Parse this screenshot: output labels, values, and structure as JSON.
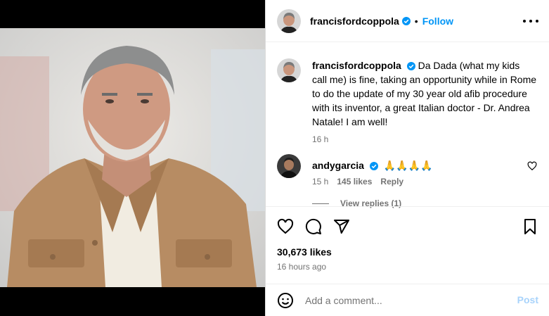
{
  "post": {
    "author": "francisfordcoppola",
    "follow_label": "Follow",
    "separator": "•",
    "caption": "Da Dada (what my kids call me) is fine, taking an opportunity while in Rome to do the update of my 30 year old afib procedure with its inventor, a great Italian doctor - Dr. Andrea Natale! I am well!",
    "caption_time": "16 h",
    "likes": "30,673 likes",
    "time_ago": "16 hours ago"
  },
  "comments": [
    {
      "username": "andygarcia",
      "text": "🙏🙏🙏🙏",
      "time": "15 h",
      "likes": "145 likes",
      "reply_label": "Reply",
      "view_replies": "View replies (1)"
    }
  ],
  "composer": {
    "placeholder": "Add a comment...",
    "post_label": "Post"
  },
  "colors": {
    "accent": "#0095f6",
    "verified": "#0095f6",
    "post_disabled": "#a8d3fb",
    "muted_text": "#737373"
  },
  "icons": [
    "verified-badge-icon",
    "more-options-icon",
    "heart-icon",
    "comment-icon",
    "share-icon",
    "save-icon",
    "emoji-icon"
  ]
}
